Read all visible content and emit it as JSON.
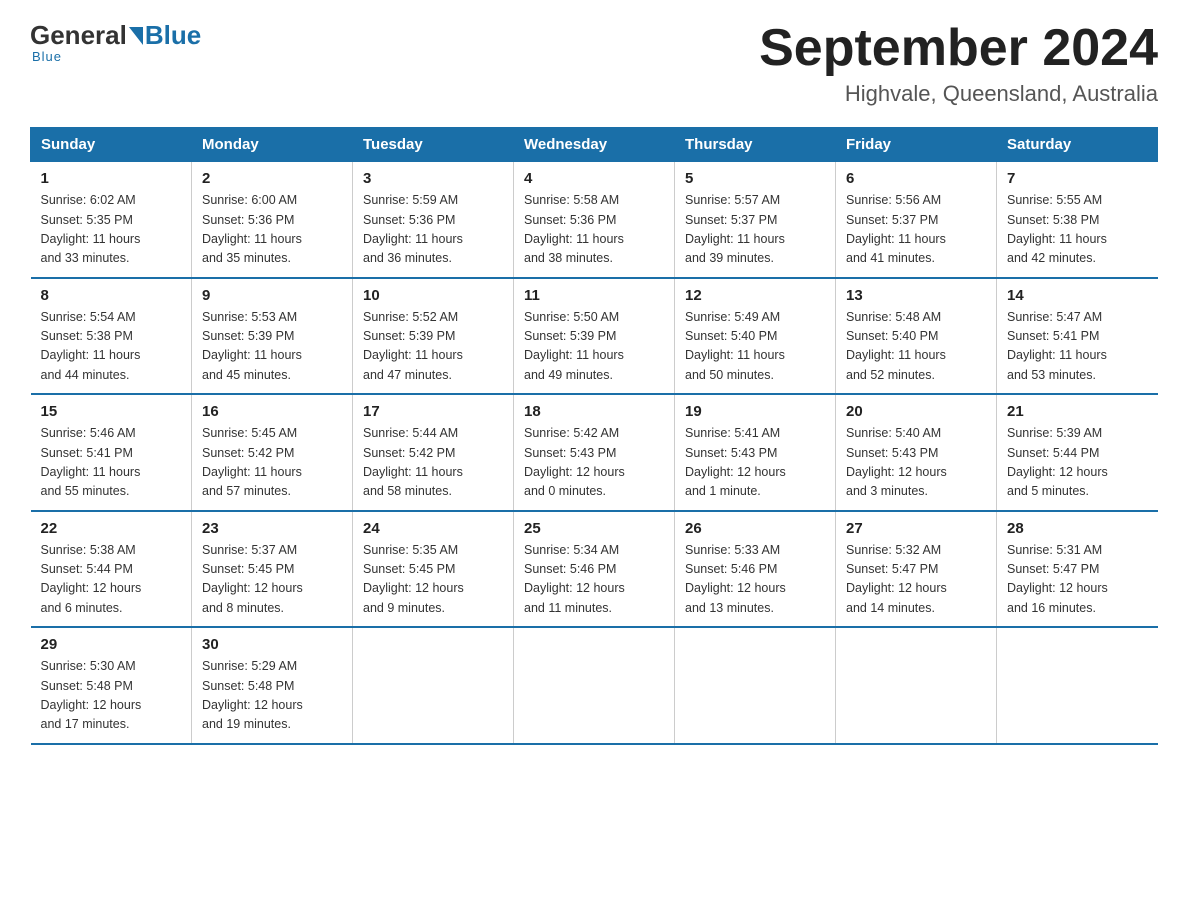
{
  "logo": {
    "general": "General",
    "blue": "Blue",
    "tagline": "Blue"
  },
  "title": "September 2024",
  "subtitle": "Highvale, Queensland, Australia",
  "days_of_week": [
    "Sunday",
    "Monday",
    "Tuesday",
    "Wednesday",
    "Thursday",
    "Friday",
    "Saturday"
  ],
  "weeks": [
    [
      {
        "day": "1",
        "sunrise": "6:02 AM",
        "sunset": "5:35 PM",
        "daylight": "11 hours and 33 minutes."
      },
      {
        "day": "2",
        "sunrise": "6:00 AM",
        "sunset": "5:36 PM",
        "daylight": "11 hours and 35 minutes."
      },
      {
        "day": "3",
        "sunrise": "5:59 AM",
        "sunset": "5:36 PM",
        "daylight": "11 hours and 36 minutes."
      },
      {
        "day": "4",
        "sunrise": "5:58 AM",
        "sunset": "5:36 PM",
        "daylight": "11 hours and 38 minutes."
      },
      {
        "day": "5",
        "sunrise": "5:57 AM",
        "sunset": "5:37 PM",
        "daylight": "11 hours and 39 minutes."
      },
      {
        "day": "6",
        "sunrise": "5:56 AM",
        "sunset": "5:37 PM",
        "daylight": "11 hours and 41 minutes."
      },
      {
        "day": "7",
        "sunrise": "5:55 AM",
        "sunset": "5:38 PM",
        "daylight": "11 hours and 42 minutes."
      }
    ],
    [
      {
        "day": "8",
        "sunrise": "5:54 AM",
        "sunset": "5:38 PM",
        "daylight": "11 hours and 44 minutes."
      },
      {
        "day": "9",
        "sunrise": "5:53 AM",
        "sunset": "5:39 PM",
        "daylight": "11 hours and 45 minutes."
      },
      {
        "day": "10",
        "sunrise": "5:52 AM",
        "sunset": "5:39 PM",
        "daylight": "11 hours and 47 minutes."
      },
      {
        "day": "11",
        "sunrise": "5:50 AM",
        "sunset": "5:39 PM",
        "daylight": "11 hours and 49 minutes."
      },
      {
        "day": "12",
        "sunrise": "5:49 AM",
        "sunset": "5:40 PM",
        "daylight": "11 hours and 50 minutes."
      },
      {
        "day": "13",
        "sunrise": "5:48 AM",
        "sunset": "5:40 PM",
        "daylight": "11 hours and 52 minutes."
      },
      {
        "day": "14",
        "sunrise": "5:47 AM",
        "sunset": "5:41 PM",
        "daylight": "11 hours and 53 minutes."
      }
    ],
    [
      {
        "day": "15",
        "sunrise": "5:46 AM",
        "sunset": "5:41 PM",
        "daylight": "11 hours and 55 minutes."
      },
      {
        "day": "16",
        "sunrise": "5:45 AM",
        "sunset": "5:42 PM",
        "daylight": "11 hours and 57 minutes."
      },
      {
        "day": "17",
        "sunrise": "5:44 AM",
        "sunset": "5:42 PM",
        "daylight": "11 hours and 58 minutes."
      },
      {
        "day": "18",
        "sunrise": "5:42 AM",
        "sunset": "5:43 PM",
        "daylight": "12 hours and 0 minutes."
      },
      {
        "day": "19",
        "sunrise": "5:41 AM",
        "sunset": "5:43 PM",
        "daylight": "12 hours and 1 minute."
      },
      {
        "day": "20",
        "sunrise": "5:40 AM",
        "sunset": "5:43 PM",
        "daylight": "12 hours and 3 minutes."
      },
      {
        "day": "21",
        "sunrise": "5:39 AM",
        "sunset": "5:44 PM",
        "daylight": "12 hours and 5 minutes."
      }
    ],
    [
      {
        "day": "22",
        "sunrise": "5:38 AM",
        "sunset": "5:44 PM",
        "daylight": "12 hours and 6 minutes."
      },
      {
        "day": "23",
        "sunrise": "5:37 AM",
        "sunset": "5:45 PM",
        "daylight": "12 hours and 8 minutes."
      },
      {
        "day": "24",
        "sunrise": "5:35 AM",
        "sunset": "5:45 PM",
        "daylight": "12 hours and 9 minutes."
      },
      {
        "day": "25",
        "sunrise": "5:34 AM",
        "sunset": "5:46 PM",
        "daylight": "12 hours and 11 minutes."
      },
      {
        "day": "26",
        "sunrise": "5:33 AM",
        "sunset": "5:46 PM",
        "daylight": "12 hours and 13 minutes."
      },
      {
        "day": "27",
        "sunrise": "5:32 AM",
        "sunset": "5:47 PM",
        "daylight": "12 hours and 14 minutes."
      },
      {
        "day": "28",
        "sunrise": "5:31 AM",
        "sunset": "5:47 PM",
        "daylight": "12 hours and 16 minutes."
      }
    ],
    [
      {
        "day": "29",
        "sunrise": "5:30 AM",
        "sunset": "5:48 PM",
        "daylight": "12 hours and 17 minutes."
      },
      {
        "day": "30",
        "sunrise": "5:29 AM",
        "sunset": "5:48 PM",
        "daylight": "12 hours and 19 minutes."
      },
      null,
      null,
      null,
      null,
      null
    ]
  ],
  "labels": {
    "sunrise": "Sunrise:",
    "sunset": "Sunset:",
    "daylight": "Daylight:"
  }
}
